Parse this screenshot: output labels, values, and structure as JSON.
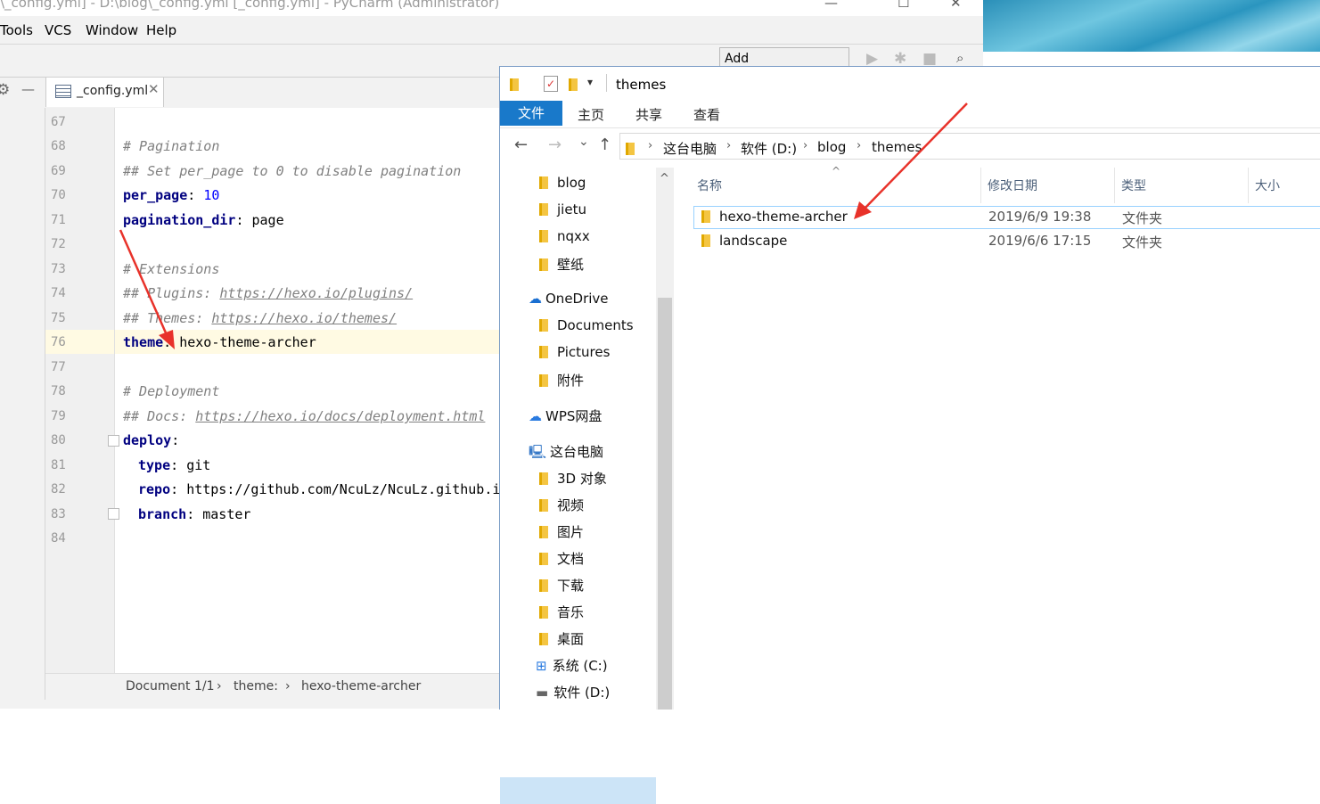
{
  "pycharm": {
    "title": "\\_config.yml] - D:\\blog\\_config.yml [_config.yml] - PyCharm (Administrator)",
    "window_buttons": [
      "—",
      "☐",
      "✕"
    ],
    "menu": [
      {
        "label": "Tools"
      },
      {
        "label": "VCS"
      },
      {
        "label": "Window"
      },
      {
        "label": "Help"
      }
    ],
    "toolbar": {
      "add_config": "Add Configuration...",
      "run_icon": "▶",
      "debug_icon": "✱",
      "stop_icon": "■",
      "search_icon": "🔍"
    },
    "left_tools": {
      "gear": "⚙",
      "minus": "—"
    },
    "tab": {
      "label": "_config.yml",
      "close": "✕"
    },
    "lines": [
      {
        "n": "67"
      },
      {
        "n": "68"
      },
      {
        "n": "69"
      },
      {
        "n": "70"
      },
      {
        "n": "71"
      },
      {
        "n": "72"
      },
      {
        "n": "73"
      },
      {
        "n": "74"
      },
      {
        "n": "75"
      },
      {
        "n": "76"
      },
      {
        "n": "77"
      },
      {
        "n": "78"
      },
      {
        "n": "79"
      },
      {
        "n": "80"
      },
      {
        "n": "81"
      },
      {
        "n": "82"
      },
      {
        "n": "83"
      },
      {
        "n": "84"
      }
    ],
    "code": {
      "l68": "# Pagination",
      "l69": "## Set per_page to 0 to disable pagination",
      "l70_key": "per_page",
      "l70_val": "10",
      "l71_key": "pagination_dir",
      "l71_val": "page",
      "l73": "# Extensions",
      "l74_pre": "## Plugins: ",
      "l74_url": "https://hexo.io/plugins/",
      "l75_pre": "## Themes: ",
      "l75_url": "https://hexo.io/themes/",
      "l76_key": "theme",
      "l76_val": "hexo-theme-archer",
      "l78": "# Deployment",
      "l79_pre": "## Docs: ",
      "l79_url": "https://hexo.io/docs/deployment.html",
      "l80_key": "deploy",
      "l81_key": "type",
      "l81_val": "git",
      "l82_key": "repo",
      "l82_val": "https://github.com/NcuLz/NcuLz.github.i",
      "l83_key": "branch",
      "l83_val": "master",
      "colon": ":"
    },
    "status": {
      "doc": "Document 1/1",
      "sep": "›",
      "crumb1": "theme:",
      "crumb2": "hexo-theme-archer"
    }
  },
  "explorer": {
    "title": "themes",
    "ribbon": {
      "file": "文件",
      "tabs": [
        "主页",
        "共享",
        "查看"
      ]
    },
    "nav_buttons": {
      "back": "←",
      "forward": "→",
      "down": "⌄",
      "up": "↑"
    },
    "path": [
      "这台电脑",
      "软件 (D:)",
      "blog",
      "themes"
    ],
    "path_sep": "›",
    "nav": [
      {
        "label": "blog"
      },
      {
        "label": "jietu"
      },
      {
        "label": "nqxx"
      },
      {
        "label": "壁纸"
      },
      {
        "label": "OneDrive"
      },
      {
        "label": "Documents"
      },
      {
        "label": "Pictures"
      },
      {
        "label": "附件"
      },
      {
        "label": "WPS网盘"
      },
      {
        "label": "这台电脑"
      },
      {
        "label": "3D 对象"
      },
      {
        "label": "视频"
      },
      {
        "label": "图片"
      },
      {
        "label": "文档"
      },
      {
        "label": "下载"
      },
      {
        "label": "音乐"
      },
      {
        "label": "桌面"
      },
      {
        "label": "系统 (C:)"
      },
      {
        "label": "软件 (D:)"
      }
    ],
    "columns": {
      "name": "名称",
      "date": "修改日期",
      "type": "类型",
      "size": "大小",
      "sort_icon": "^"
    },
    "files": [
      {
        "name": "hexo-theme-archer",
        "date": "2019/6/9 19:38",
        "type": "文件夹"
      },
      {
        "name": "landscape",
        "date": "2019/6/6 17:15",
        "type": "文件夹"
      }
    ],
    "scroll_up": "^"
  },
  "colors": {
    "accent": "#1979ca",
    "arrow": "#e8322a",
    "selection": "#cce4f7"
  }
}
